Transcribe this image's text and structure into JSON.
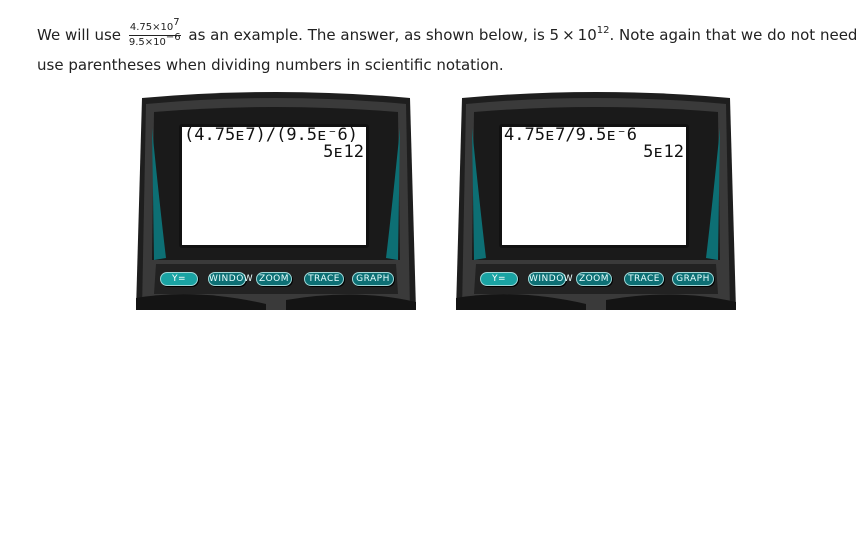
{
  "intro": {
    "prefix": "We will use",
    "example_numerator_mantissa": "4.75×10",
    "example_numerator_exp": "7",
    "example_denominator_mantissa": "9.5×10",
    "example_denominator_exp": "−6",
    "middle": "as an example. The answer, as shown below, is 5 × 10",
    "answer_exp": "12",
    "suffix": ". Note again that we do not need to",
    "line2": "use parentheses when dividing numbers in scientific notation."
  },
  "calculators": [
    {
      "entry": "(4.75ᴇ7)/(9.5ᴇ⁻6)",
      "result": "5ᴇ12",
      "keys": [
        "Y=",
        "WINDOW",
        "ZOOM",
        "TRACE",
        "GRAPH"
      ]
    },
    {
      "entry": "4.75ᴇ7/9.5ᴇ⁻6",
      "result": "5ᴇ12",
      "keys": [
        "Y=",
        "WINDOW",
        "ZOOM",
        "TRACE",
        "GRAPH"
      ]
    }
  ],
  "colors": {
    "calc_body": "#2b2b2b",
    "calc_bezel": "#111111",
    "calc_accent": "#0d6f74",
    "key_border": "#9fd7d7"
  }
}
